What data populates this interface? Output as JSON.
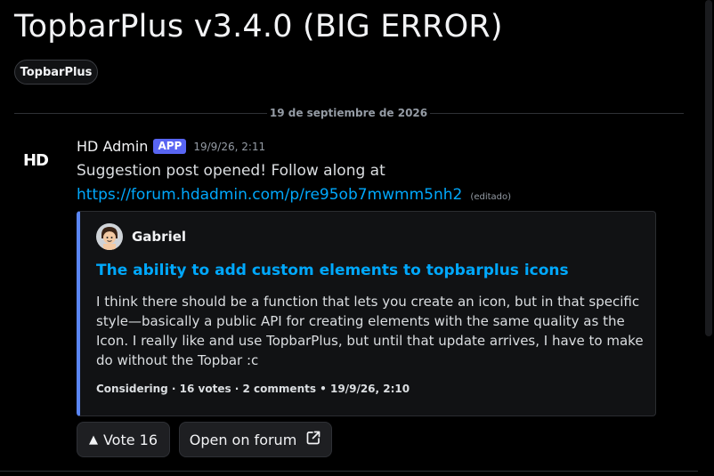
{
  "thread": {
    "title": "TopbarPlus v3.4.0 (BIG ERROR)",
    "tag": "TopbarPlus"
  },
  "divider": {
    "date": "19 de septiembre de 2026"
  },
  "message": {
    "avatar_text": "HD",
    "author": "HD Admin",
    "badge": "APP",
    "timestamp": "19/9/26, 2:11",
    "text": "Suggestion post opened! Follow along at",
    "link": "https://forum.hdadmin.com/p/re95ob7mwmm5nh2",
    "edited": "(editado)"
  },
  "embed": {
    "author": "Gabriel",
    "title": "The ability to add custom elements to topbarplus icons",
    "description_lines": [
      "I think there should be a function that lets you create an icon, but in that specific",
      "style—basically a public API for creating elements with the same quality as the",
      "Icon. I really like and use TopbarPlus, but until that update arrives, I have to make",
      "do without the Topbar :c"
    ],
    "footer": "Considering · 16 votes · 2 comments • 19/9/26, 2:10",
    "accent_color": "#5a86f5"
  },
  "buttons": {
    "vote_label": "Vote 16",
    "vote_icon": "triangle-up-icon",
    "open_label": "Open on forum",
    "open_icon": "external-link-icon"
  },
  "colors": {
    "background": "#000000",
    "link": "#00a8fc",
    "badge": "#5865f2"
  }
}
